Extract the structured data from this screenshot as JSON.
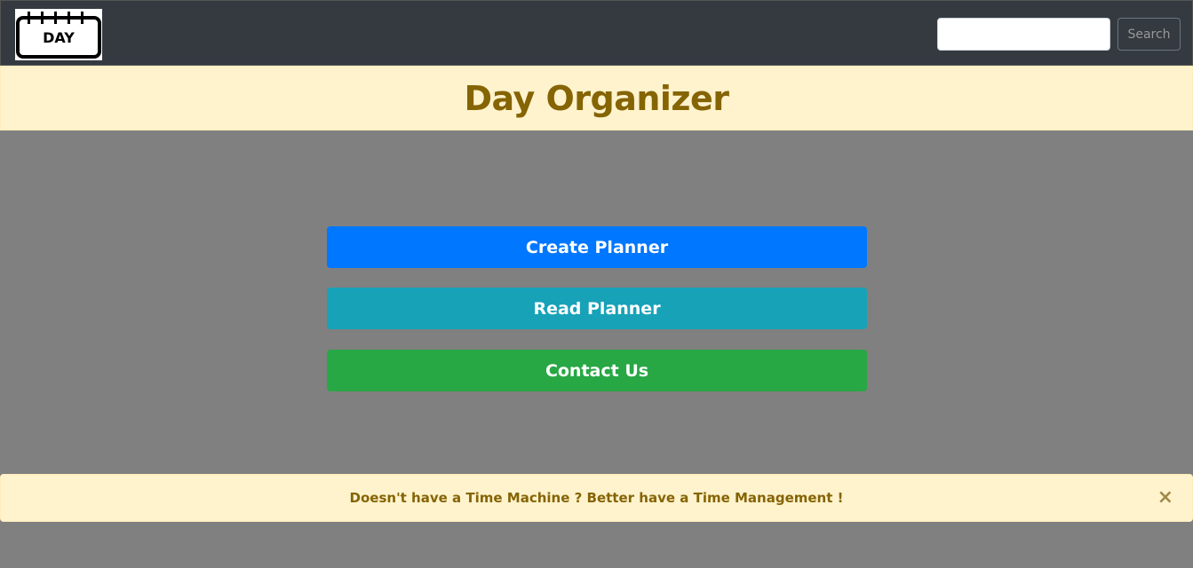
{
  "navbar": {
    "logo_text": "DAY",
    "search_placeholder": "",
    "search_value": "",
    "search_button_label": "Search"
  },
  "header": {
    "title": "Day Organizer"
  },
  "actions": {
    "create_label": "Create Planner",
    "read_label": "Read Planner",
    "contact_label": "Contact Us"
  },
  "alert": {
    "message": "Doesn't have a Time Machine ? Better have a Time Management !",
    "close_symbol": "×"
  },
  "colors": {
    "navbar_bg": "#343a40",
    "page_bg": "#808080",
    "banner_bg": "#fff3cd",
    "banner_text": "#856404",
    "create_btn": "#0077ff",
    "read_btn": "#17a2b8",
    "contact_btn": "#28a745"
  },
  "icons": {
    "logo": "calendar-day-icon",
    "close": "close-icon"
  }
}
